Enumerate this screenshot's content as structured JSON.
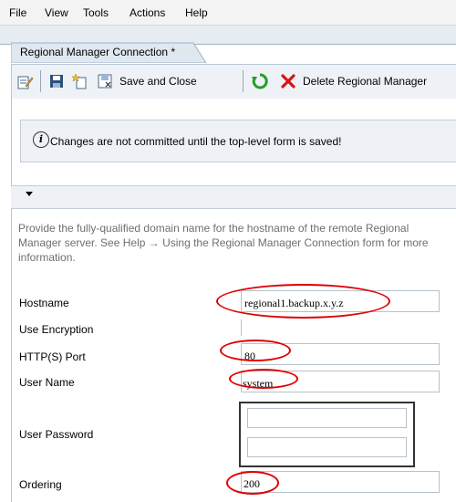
{
  "menu": [
    "File",
    "View",
    "Tools",
    "Actions",
    "Help"
  ],
  "tab": {
    "title": "Regional Manager Connection *"
  },
  "toolbar": {
    "save_close_label": "Save and Close",
    "delete_label": "Delete Regional Manager"
  },
  "info": {
    "message": "Changes are not committed until the top-level form is saved!"
  },
  "description": "Provide the fully-qualified domain name for the hostname of the remote Regional Manager server. See Help → Using the Regional Manager Connection form for more information.",
  "form": {
    "hostname": {
      "label": "Hostname",
      "value": "regional1.backup.x.y.z"
    },
    "encryption": {
      "label": "Use Encryption"
    },
    "port": {
      "label": "HTTP(S) Port",
      "value": "80"
    },
    "username": {
      "label": "User Name",
      "value": "system"
    },
    "password": {
      "label": "User Password"
    },
    "ordering": {
      "label": "Ordering",
      "value": "200"
    }
  },
  "colors": {
    "annotation": "#e00000",
    "toolbar_bg": "#eef2f6",
    "accent_icon": "#2a9d2a",
    "delete_icon": "#d61515"
  }
}
